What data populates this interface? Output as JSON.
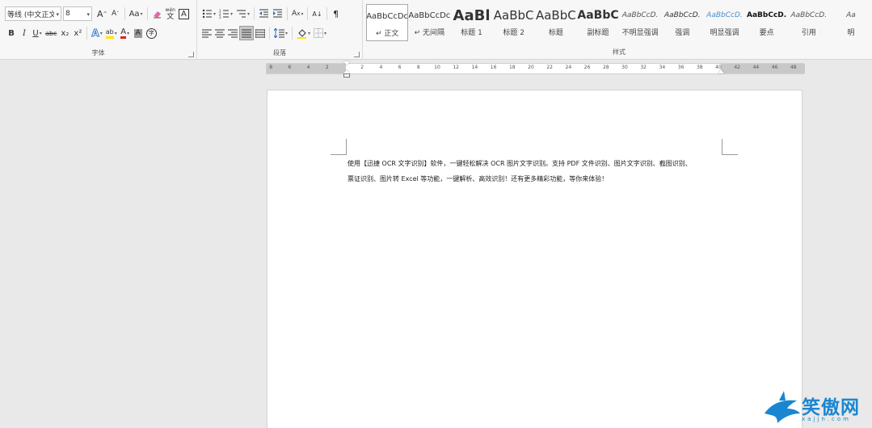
{
  "font_group": {
    "label": "字体",
    "font_name": "等线 (中文正文",
    "font_size": "8",
    "grow_font": "A",
    "shrink_font": "A",
    "change_case": "Aa",
    "phonetic_guide": "wén",
    "char_border": "A",
    "bold": "B",
    "italic": "I",
    "underline": "U",
    "strikethrough": "abc",
    "subscript": "x₂",
    "superscript": "x²",
    "text_effects": "A",
    "highlight": "ab",
    "font_color": "A",
    "char_shading": "A",
    "enclose_char": "字"
  },
  "paragraph_group": {
    "label": "段落",
    "asian_layout": "A",
    "sort": "A↓"
  },
  "styles_group": {
    "label": "样式",
    "items": [
      {
        "sample": "AaBbCcDc",
        "name": "↵ 正文",
        "selected": true
      },
      {
        "sample": "AaBbCcDc",
        "name": "↵ 无间隔",
        "selected": false
      },
      {
        "sample": "AaBl",
        "name": "标题 1",
        "selected": false
      },
      {
        "sample": "AaBbC",
        "name": "标题 2",
        "selected": false
      },
      {
        "sample": "AaBbC",
        "name": "标题",
        "selected": false
      },
      {
        "sample": "AaBbC",
        "name": "副标题",
        "selected": false
      },
      {
        "sample": "AaBbCcD.",
        "name": "不明显强调",
        "selected": false
      },
      {
        "sample": "AaBbCcD.",
        "name": "强调",
        "selected": false
      },
      {
        "sample": "AaBbCcD.",
        "name": "明显强调",
        "selected": false
      },
      {
        "sample": "AaBbCcD.",
        "name": "要点",
        "selected": false
      },
      {
        "sample": "AaBbCcD.",
        "name": "引用",
        "selected": false
      },
      {
        "sample": "Aa",
        "name": "明",
        "selected": false
      }
    ]
  },
  "ruler": {
    "left_labels": [
      "8",
      "6",
      "4",
      "2"
    ],
    "right_labels": [
      "2",
      "4",
      "6",
      "8",
      "10",
      "12",
      "14",
      "16",
      "18",
      "20",
      "22",
      "24",
      "26",
      "28",
      "30",
      "32",
      "34",
      "36",
      "38",
      "40",
      "42",
      "44",
      "46",
      "48"
    ]
  },
  "document": {
    "line1": "使用【迅捷 OCR 文字识别】软件，一键轻松解决 OCR 图片文字识别。支持 PDF 文件识别、图片文字识别、截图识别、",
    "line2": "票证识别、图片转 Excel 等功能，一键解析、高效识别！还有更多精彩功能，等你来体验！"
  },
  "watermark": {
    "title": "笑傲网",
    "subtitle": "xajjn.com"
  },
  "colors": {
    "ribbon_bg": "#f7f7f7",
    "workspace_bg": "#e9e9e9",
    "highlight_yellow": "#ffe600",
    "font_color_red": "#e02020",
    "logo_blue": "#1a86d1",
    "emphasis_blue": "#4a8fd4"
  }
}
